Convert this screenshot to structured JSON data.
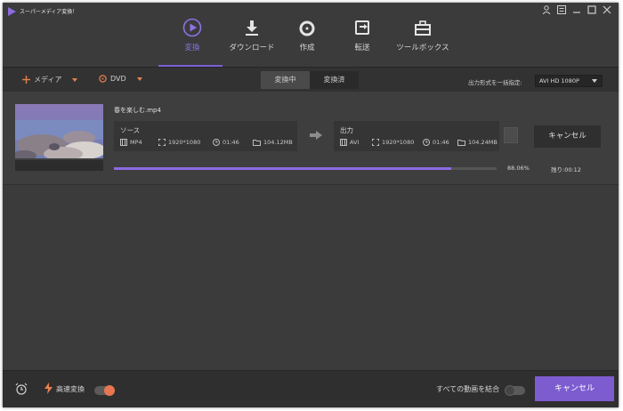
{
  "app": {
    "title": "スーパーメディア変換！",
    "logo_icon": "play-triangle-logo",
    "accent": "#7b5fd6",
    "orange": "#e8804f"
  },
  "window_controls": [
    "user-icon",
    "menu-icon",
    "minimize-icon",
    "maximize-icon",
    "close-icon"
  ],
  "nav": {
    "items": [
      {
        "label": "変換",
        "icon": "convert-icon",
        "active": true
      },
      {
        "label": "ダウンロード",
        "icon": "download-icon",
        "active": false
      },
      {
        "label": "作成",
        "icon": "burn-disc-icon",
        "active": false
      },
      {
        "label": "転送",
        "icon": "transfer-icon",
        "active": false
      },
      {
        "label": "ツールボックス",
        "icon": "toolbox-icon",
        "active": false
      }
    ]
  },
  "toolbar": {
    "add_media": "メディア",
    "dvd": "DVD",
    "tabs": [
      {
        "label": "変換中",
        "active": true
      },
      {
        "label": "変換済",
        "active": false
      }
    ],
    "output_label": "出力形式を一括指定:",
    "output_value": "AVI HD 1080P"
  },
  "task": {
    "filename": "春を楽しむ.mp4",
    "source": {
      "title": "ソース",
      "format": "MP4",
      "resolution": "1920*1080",
      "duration": "01:46",
      "size": "104.12MB"
    },
    "output": {
      "title": "出力",
      "format": "AVI",
      "resolution": "1920*1080",
      "duration": "01:46",
      "size": "104.24MB"
    },
    "cancel": "キャンセル",
    "progress": 0.8806,
    "progress_text": "88.06%",
    "remaining": "残り:00:12"
  },
  "footer": {
    "fast_convert": "高速変換",
    "fast_convert_on": true,
    "merge_all": "すべての動画を結合",
    "merge_on": false,
    "cancel_all": "キャンセル"
  }
}
